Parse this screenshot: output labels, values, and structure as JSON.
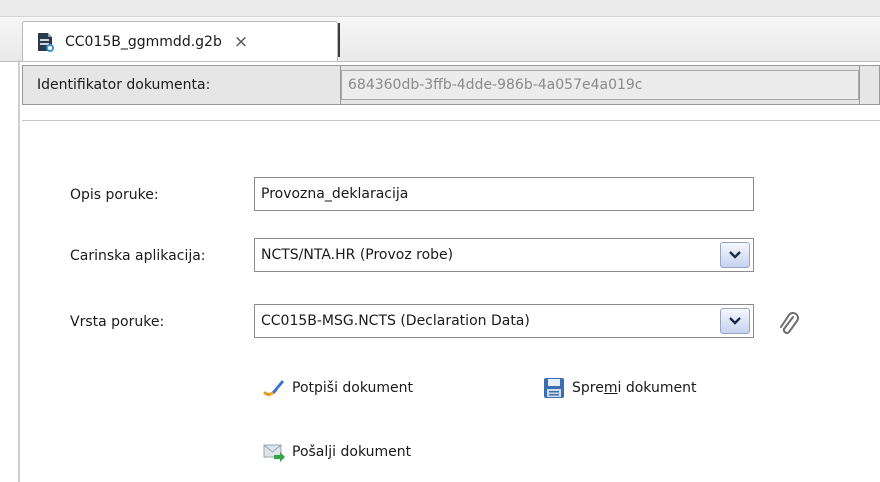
{
  "tab": {
    "title": "CC015B_ggmmdd.g2b",
    "close_glyph": "×",
    "icon": "document-icon"
  },
  "identifier": {
    "label": "Identifikator dokumenta:",
    "value": "684360db-3ffb-4dde-986b-4a057e4a019c"
  },
  "form": {
    "opis": {
      "label": "Opis poruke:",
      "value": "Provozna_deklaracija"
    },
    "carinska": {
      "label": "Carinska aplikacija:",
      "value": "NCTS/NTA.HR (Provoz robe)"
    },
    "vrsta": {
      "label": "Vrsta poruke:",
      "value": "CC015B-MSG.NCTS (Declaration Data)",
      "attach_icon": "paperclip-icon"
    }
  },
  "actions": {
    "sign": {
      "label": "Potpiši dokument",
      "icon": "sign-icon"
    },
    "save": {
      "label_pre": "Spre",
      "label_mnemonic": "m",
      "label_post": "i dokument",
      "icon": "floppy-disk-icon"
    },
    "send": {
      "label": "Pošalji dokument",
      "icon": "send-envelope-icon"
    }
  },
  "colors": {
    "header_bg": "#e6e6e6",
    "identifier_text": "#8a8a8a",
    "dropdown_btn": "#c6d2ef"
  }
}
